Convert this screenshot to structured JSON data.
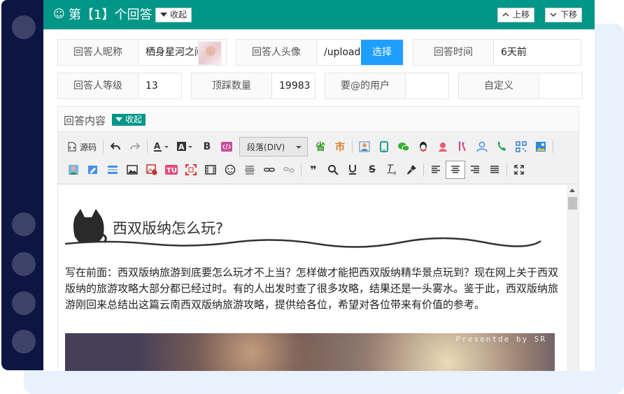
{
  "header": {
    "title": "第【1】个回答",
    "collapse_label": "收起",
    "move_up_label": "上移",
    "move_down_label": "下移"
  },
  "fields_row1": [
    {
      "label": "回答人昵称",
      "value": "栖身星河之间"
    },
    {
      "label": "回答人头像",
      "value": "/upload",
      "button": "选择"
    },
    {
      "label": "回答时间",
      "value": "6天前"
    }
  ],
  "fields_row2": [
    {
      "label": "回答人等级",
      "value": "13"
    },
    {
      "label": "顶踩数量",
      "value": "19983"
    },
    {
      "label": "要@的用户",
      "value": ""
    },
    {
      "label": "自定义",
      "value": ""
    }
  ],
  "content": {
    "title": "回答内容",
    "collapse_label": "收起"
  },
  "toolbar": {
    "source_label": "源码",
    "paragraph_select": "段落(DIV)",
    "province_label": "省",
    "city_label": "市",
    "row1_icons": [
      "source-icon",
      "undo-icon",
      "redo-icon",
      "font-color-icon",
      "background-color-icon",
      "bold-icon",
      "code-icon",
      "paragraph-select",
      "province-icon",
      "city-icon",
      "contact-card-icon",
      "mobile-icon",
      "wechat-icon",
      "qq-icon",
      "customer-service-icon",
      "people-icon",
      "user-group-icon",
      "phone-icon",
      "qrcode-icon",
      "image-gallery-icon"
    ],
    "row2_icons": [
      "avatar-icon",
      "edit-image-icon",
      "layout-icon",
      "image-icon",
      "insert-image-icon",
      "tu-icon",
      "crop-icon",
      "video-icon",
      "emoji-icon",
      "horizontal-rule-icon",
      "link-icon",
      "unlink-icon",
      "quote-icon",
      "search-icon",
      "underline-icon",
      "strikethrough-icon",
      "clear-format-icon",
      "format-brush-icon",
      "align-left-icon",
      "align-center-icon",
      "align-right-icon",
      "align-justify-icon",
      "fullscreen-icon"
    ]
  },
  "document": {
    "heading": "西双版纳怎么玩?",
    "body": "写在前面：西双版纳旅游到底要怎么玩才不上当？怎样做才能把西双版纳精华景点玩到？现在网上关于西双版纳的旅游攻略大部分都已经过时。有的人出发时查了很多攻略，结果还是一头雾水。鉴于此，西双版纳旅游刚回来总结出这篇云南西双版纳旅游攻略，提供给各位，希望对各位带来有价值的参考。",
    "image_caption": "Presentde by SR"
  },
  "colors": {
    "header": "#009688",
    "select_button": "#1e9fff",
    "dark_sidebar": "#0d1543",
    "backdrop": "#e8f1fc"
  }
}
